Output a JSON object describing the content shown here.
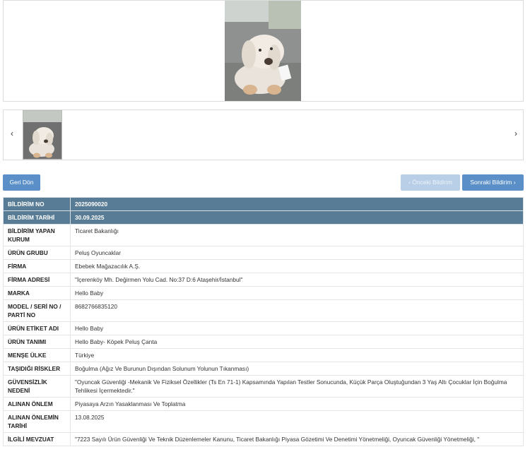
{
  "navigation": {
    "back_label": "Geri Dön",
    "prev_label": "‹ Önceki Bildirim",
    "next_label": "Sonraki Bildirim ›",
    "carousel_prev": "‹",
    "carousel_next": "›"
  },
  "details": {
    "rows": [
      {
        "label": "BİLDİRİM NO",
        "value": "2025090020"
      },
      {
        "label": "BİLDİRİM TARİHİ",
        "value": "30.09.2025"
      },
      {
        "label": "BİLDİRİM YAPAN KURUM",
        "value": "Ticaret Bakanlığı"
      },
      {
        "label": "ÜRÜN GRUBU",
        "value": "Peluş Oyuncaklar"
      },
      {
        "label": "FİRMA",
        "value": "Ebebek Mağazacılık A.Ş."
      },
      {
        "label": "FİRMA ADRESİ",
        "value": "\"İçerenköy Mh. Değirmen Yolu Cad. No:37 D:6 Ataşehir/İstanbul\""
      },
      {
        "label": "MARKA",
        "value": "Hello Baby"
      },
      {
        "label": "MODEL / SERİ NO / PARTİ NO",
        "value": "8682766835120"
      },
      {
        "label": "ÜRÜN ETİKET ADI",
        "value": "Hello Baby"
      },
      {
        "label": "ÜRÜN TANIMI",
        "value": "Hello Baby- Köpek Peluş Çanta"
      },
      {
        "label": "MENŞE ÜLKE",
        "value": "Türkiye"
      },
      {
        "label": "TAŞIDIĞI RİSKLER",
        "value": "Boğulma (Ağız Ve Burunun Dışından Solunum Yolunun Tıkanması)"
      },
      {
        "label": "GÜVENSİZLİK NEDENİ",
        "value": "\"Oyuncak Güvenliği -Mekanik Ve Fiziksel Özellikler (Ts En 71-1) Kapsamında Yapılan Testler Sonucunda, Küçük Parça Oluştuğundan 3 Yaş Altı Çocuklar İçin Boğulma Tehlikesi İçermektedir.\""
      },
      {
        "label": "ALINAN ÖNLEM",
        "value": "Piyasaya Arzın Yasaklanması Ve Toplatma"
      },
      {
        "label": "ALINAN ÖNLEMİN TARİHİ",
        "value": "13.08.2025"
      },
      {
        "label": "İLGİLİ MEVZUAT",
        "value": "\"7223 Sayılı Ürün Güvenliği Ve Teknik Düzenlemeler Kanunu, Ticaret Bakanlığı Piyasa Gözetimi Ve Denetimi Yönetmeliği, Oyuncak Güvenliği Yönetmeliği, \""
      }
    ]
  },
  "colors": {
    "header_row": "#587c95",
    "button": "#5b8fc7",
    "button_disabled": "#b9cfe7"
  }
}
